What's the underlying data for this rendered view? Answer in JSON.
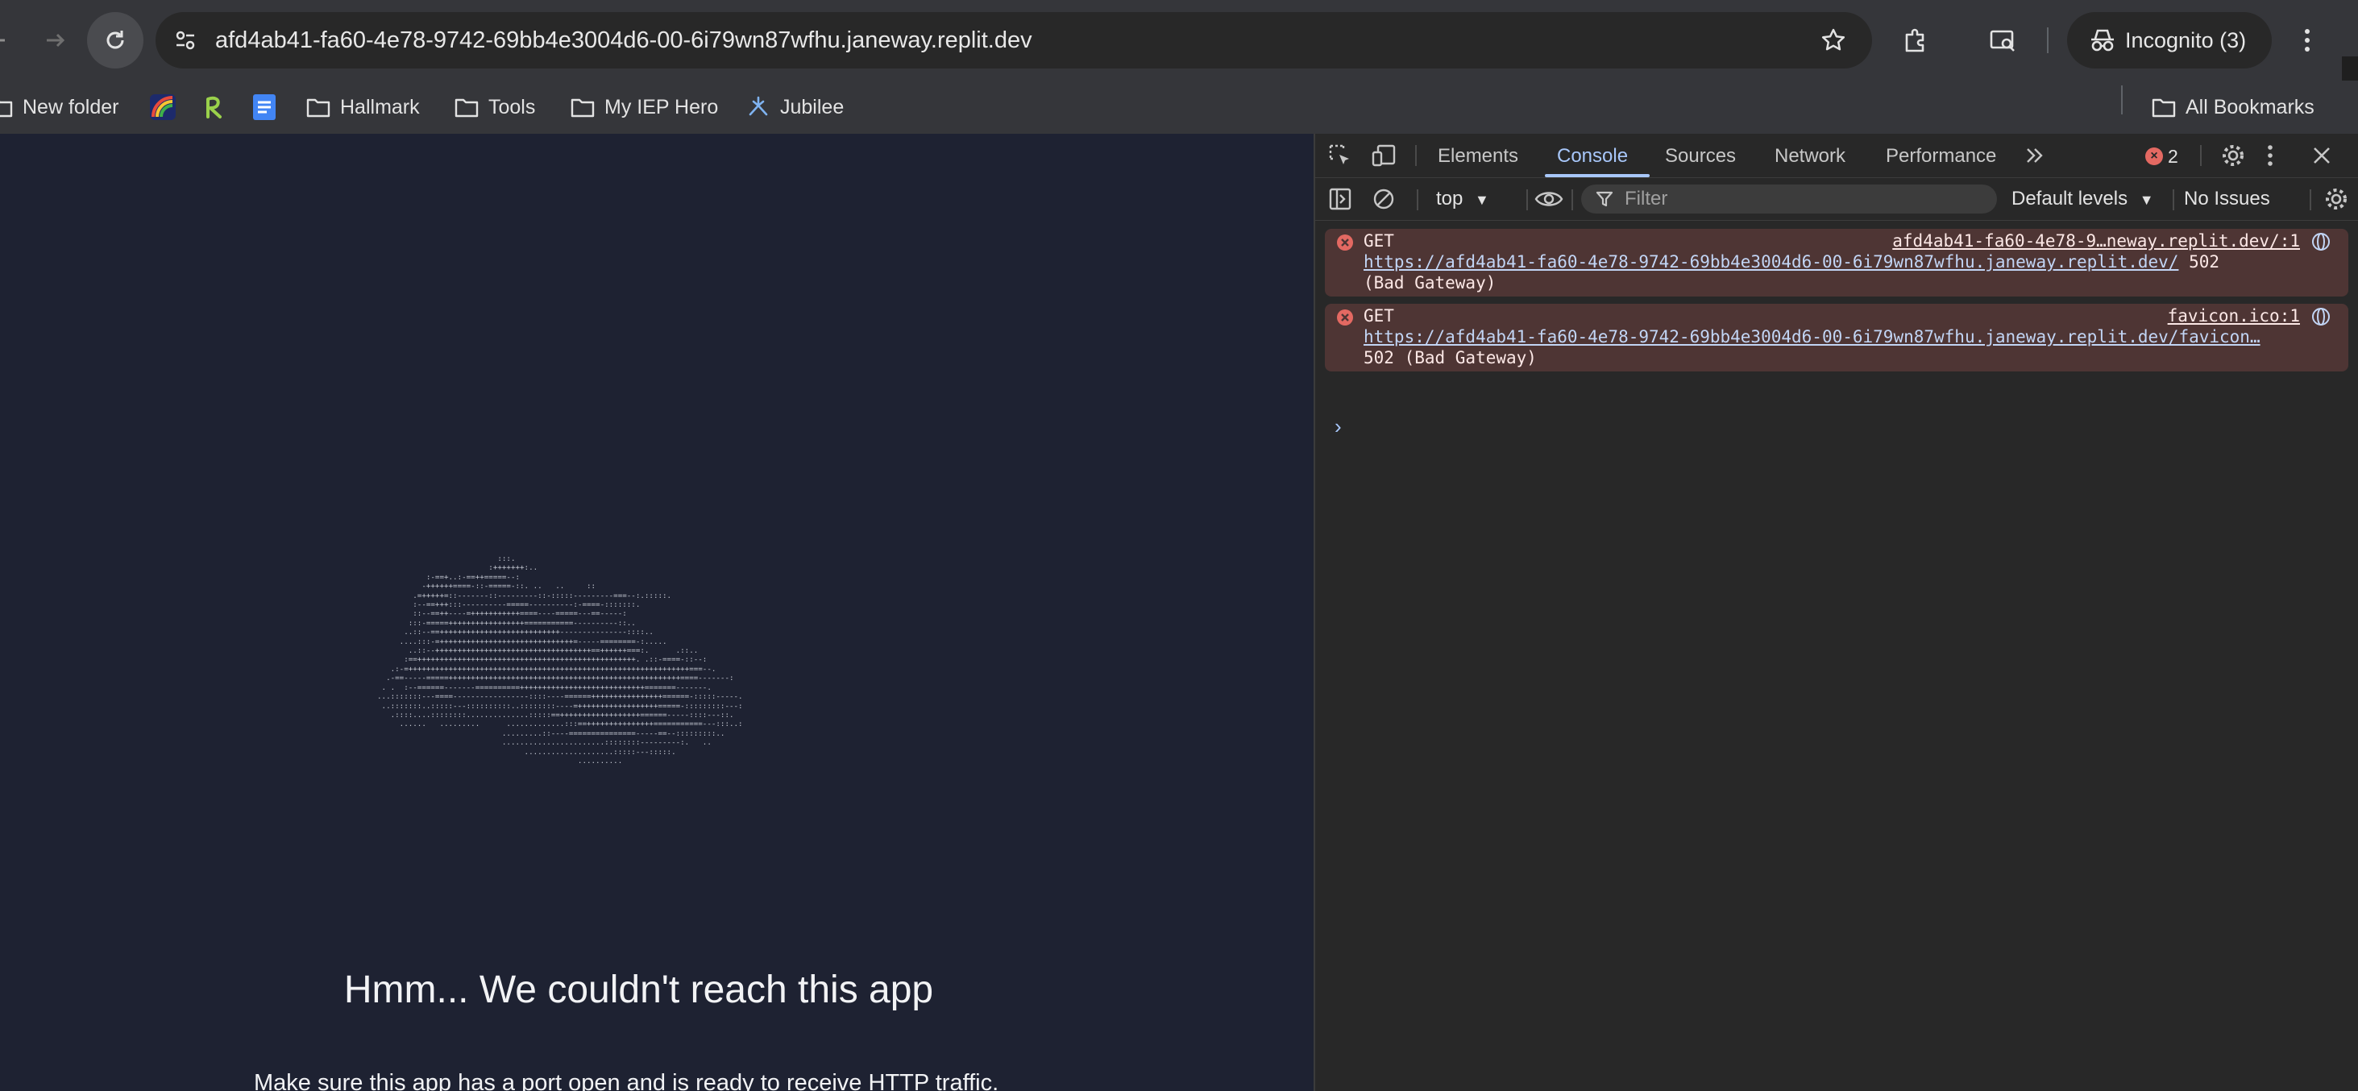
{
  "browser": {
    "url": "afd4ab41-fa60-4e78-9742-69bb4e3004d6-00-6i79wn87wfhu.janeway.replit.dev",
    "profile_label": "Incognito (3)"
  },
  "bookmarks": {
    "items": [
      {
        "label": "New folder",
        "icon": "folder-icon"
      },
      {
        "label": "",
        "icon": "rainbow-app-icon"
      },
      {
        "label": "",
        "icon": "replit-r-icon"
      },
      {
        "label": "",
        "icon": "google-docs-icon"
      },
      {
        "label": "Hallmark",
        "icon": "folder-icon"
      },
      {
        "label": "Tools",
        "icon": "folder-icon"
      },
      {
        "label": "My IEP Hero",
        "icon": "folder-icon"
      },
      {
        "label": "Jubilee",
        "icon": "jubilee-icon"
      }
    ],
    "all_bookmarks": "All Bookmarks"
  },
  "page": {
    "ascii_art": "                           :::.\n                         :+++++++:..\n           :-==+..:-==++=====--:\n          -++++++====-::-=====-::. ..   ..     ::\n        .=+++++=::-------::---------::-:::::---------===--:.:::::.\n        :--==+++:::----------=====----------:-====-:::::::.\n        ::--==++----=+++++++++++====----=====---==-----:\n       :::-=====+++++++++++++++++===========----------::..\n      ..::--==+++++++++++++++++++++++++++---------------::::..\n     ....:::-=++++++++++++++++++++++++++++++=-----========-:.....\n       ..::--+++++++++++++++++++++++++++++++++++==++++++===:.      .::..\n      :==+++++++++++++++++++++++++++++++++++++++++++++++++. .::-====-::--:\n   .:-=+++++++++++++++++++++++++++++++++++++++++++++++++++++++++++++++===--.\n  .-==-----=====++++++++++++++++++++++++++++++++++++++++++++++++++++====-------:\n . .  :--======-------==========++++++++++++++++++++++++++++=======-------.\n...:::::::---====-----------------::::----======++++++++++++++++======-:::::-----.\n ..:::::::..:::::---::::::::::..::::::::----=++++++++++++++++++=====-:::::::::---:\n   .::::....::::::::..............:::::==++++++++++++++++++======-----::::---::.\n     ......   .........      .............:::==+++++++++++++++===========---:::..:\n                            .........::----===============-----==--:::::::::..\n                            .......................::::::::---------:.   ..\n                                 ....................:::::---:::::.\n                                             ..........",
    "heading": "Hmm... We couldn't reach this app",
    "paragraph": "Make sure this app has a port open and is ready to receive HTTP traffic."
  },
  "devtools": {
    "tabs": [
      "Elements",
      "Console",
      "Sources",
      "Network",
      "Performance"
    ],
    "active_tab": "Console",
    "more_tabs_icon": "double-chevron-icon",
    "error_count": "2",
    "context": "top",
    "filter_placeholder": "Filter",
    "levels": "Default levels",
    "issues": "No Issues",
    "messages": [
      {
        "method": "GET",
        "source": "afd4ab41-fa60-4e78-9…neway.replit.dev/:1",
        "url": "https://afd4ab41-fa60-4e78-9742-69bb4e3004d6-00-6i79wn87wfhu.janeway.replit.dev/",
        "status_inline": " 502",
        "status_tail": "(Bad Gateway)"
      },
      {
        "method": "GET",
        "source": "favicon.ico:1",
        "url": "https://afd4ab41-fa60-4e78-9742-69bb4e3004d6-00-6i79wn87wfhu.janeway.replit.dev/favicon…",
        "status_inline": "",
        "status_tail": "502 (Bad Gateway)"
      }
    ],
    "prompt": "›"
  },
  "colors": {
    "page_bg": "#1e2232",
    "devtools_bg": "#282828",
    "error_bg": "#4e3534",
    "accent": "#a8c7fa"
  }
}
